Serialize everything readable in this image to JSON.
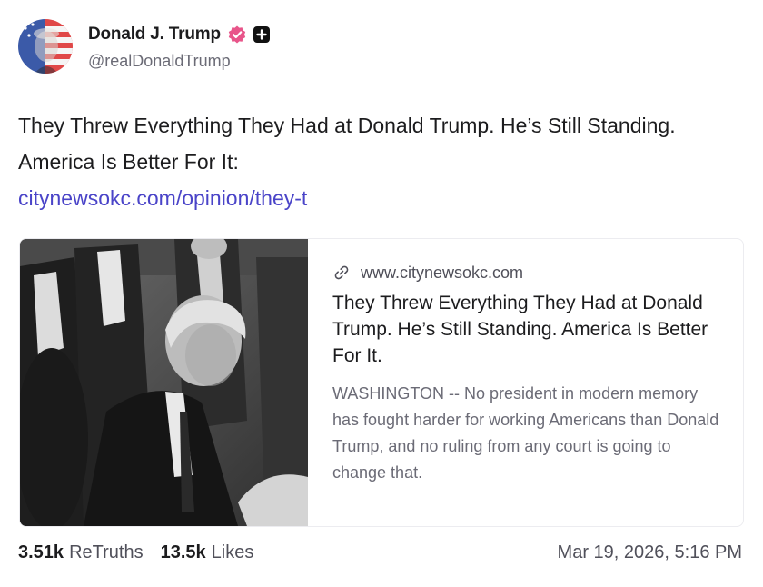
{
  "author": {
    "display_name": "Donald J. Trump",
    "handle": "@realDonaldTrump",
    "verified_badge_color": "#e8558a"
  },
  "post": {
    "text": "They Threw Everything They Had at Donald Trump. He’s Still Standing. America Is Better For It:",
    "link_text": "citynewsokc.com/opinion/they-t",
    "link_color": "#4a44c8"
  },
  "link_card": {
    "domain": "www.citynewsokc.com",
    "title": "They Threw Everything They Had at Donald Trump. He’s Still Standing. America Is Better For It.",
    "description": "WASHINGTON -- No president in modern memory has fought harder for working Americans than Donald Trump, and no ruling from any court is going to change that."
  },
  "stats": {
    "retruths_count": "3.51k",
    "retruths_label": "ReTruths",
    "likes_count": "13.5k",
    "likes_label": "Likes",
    "timestamp": "Mar 19, 2026, 5:16 PM"
  },
  "icons": {
    "verified": "verified-check-icon",
    "badge": "plus-badge-icon",
    "link": "link-icon"
  }
}
